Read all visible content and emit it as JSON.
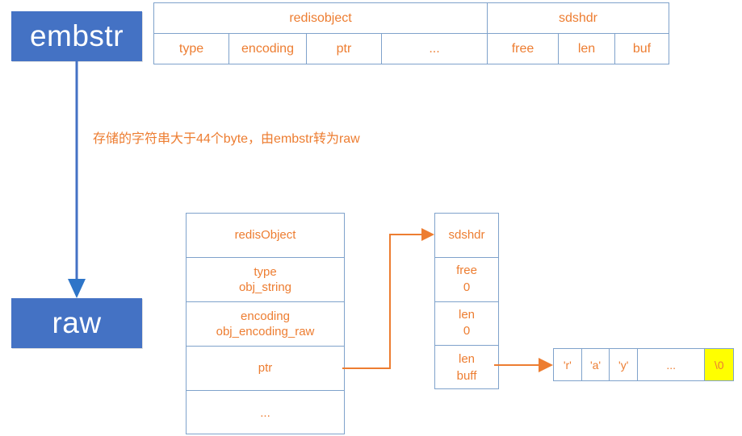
{
  "diagram": {
    "title": "redis string encoding: embstr to raw",
    "colors": {
      "box_blue": "#4472C4",
      "arrow_blue": "#4472C4",
      "text_orange": "#ED7D31",
      "border_blue": "#7FA2CB",
      "highlight_yellow": "#FFFF00",
      "box_text": "#FFFFFF"
    }
  },
  "states": {
    "from_label": "embstr",
    "to_label": "raw"
  },
  "transition": {
    "caption": "存储的字符串大于44个byte，由embstr转为raw",
    "arrow_icon": "down-arrow-icon"
  },
  "embstr_layout": {
    "headers": [
      {
        "label": "redisobject",
        "span": 4
      },
      {
        "label": "sdshdr",
        "span": 3
      }
    ],
    "fields": [
      "type",
      "encoding",
      "ptr",
      "...",
      "free",
      "len",
      "buf"
    ]
  },
  "raw_layout": {
    "redis_object": {
      "title": "redisObject",
      "rows": [
        {
          "name": "type",
          "value": "obj_string"
        },
        {
          "name": "encoding",
          "value": "obj_encoding_raw"
        },
        {
          "name": "ptr",
          "value": ""
        },
        {
          "name": "...",
          "value": ""
        }
      ]
    },
    "sdshdr": {
      "title": "sdshdr",
      "rows": [
        {
          "name": "free",
          "value": "0"
        },
        {
          "name": "len",
          "value": "0"
        },
        {
          "name": "len",
          "value": "buff"
        }
      ]
    },
    "char_buffer": {
      "cells": [
        "'r'",
        "'a'",
        "'y'",
        "...",
        "\\0"
      ],
      "terminator_index": 4
    },
    "connectors": [
      {
        "from": "ptr",
        "to": "sdshdr",
        "icon": "arrow-right-icon"
      },
      {
        "from": "buff",
        "to": "char-buffer",
        "icon": "arrow-right-icon"
      }
    ]
  }
}
